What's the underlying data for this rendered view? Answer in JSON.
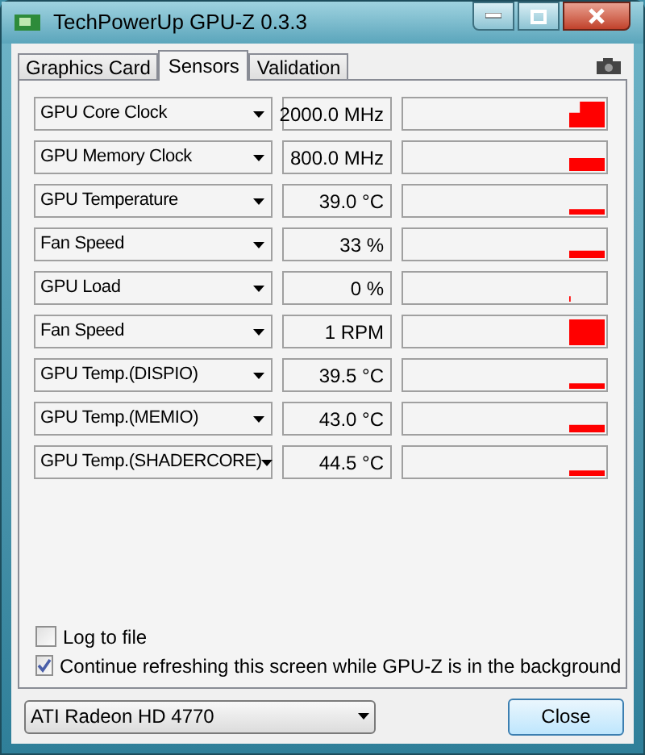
{
  "window": {
    "title": "TechPowerUp GPU-Z 0.3.3"
  },
  "tabs": [
    {
      "label": "Graphics Card",
      "selected": false
    },
    {
      "label": "Sensors",
      "selected": true
    },
    {
      "label": "Validation",
      "selected": false
    }
  ],
  "sensors": [
    {
      "name": "GPU Core Clock",
      "value": "2000.0 MHz"
    },
    {
      "name": "GPU Memory Clock",
      "value": "800.0 MHz"
    },
    {
      "name": "GPU Temperature",
      "value": "39.0 °C"
    },
    {
      "name": "Fan Speed",
      "value": "33 %"
    },
    {
      "name": "GPU Load",
      "value": "0 %"
    },
    {
      "name": "Fan Speed",
      "value": "1 RPM"
    },
    {
      "name": "GPU Temp.(DISPIO)",
      "value": "39.5 °C"
    },
    {
      "name": "GPU Temp.(MEMIO)",
      "value": "43.0 °C"
    },
    {
      "name": "GPU Temp.(SHADERCORE)",
      "value": "44.5 °C"
    }
  ],
  "options": [
    {
      "label": "Log to file",
      "checked": false
    },
    {
      "label": "Continue refreshing this screen while GPU-Z is in the background",
      "checked": true
    }
  ],
  "gpu_select": {
    "value": "ATI Radeon HD 4770"
  },
  "buttons": [
    "Close"
  ]
}
